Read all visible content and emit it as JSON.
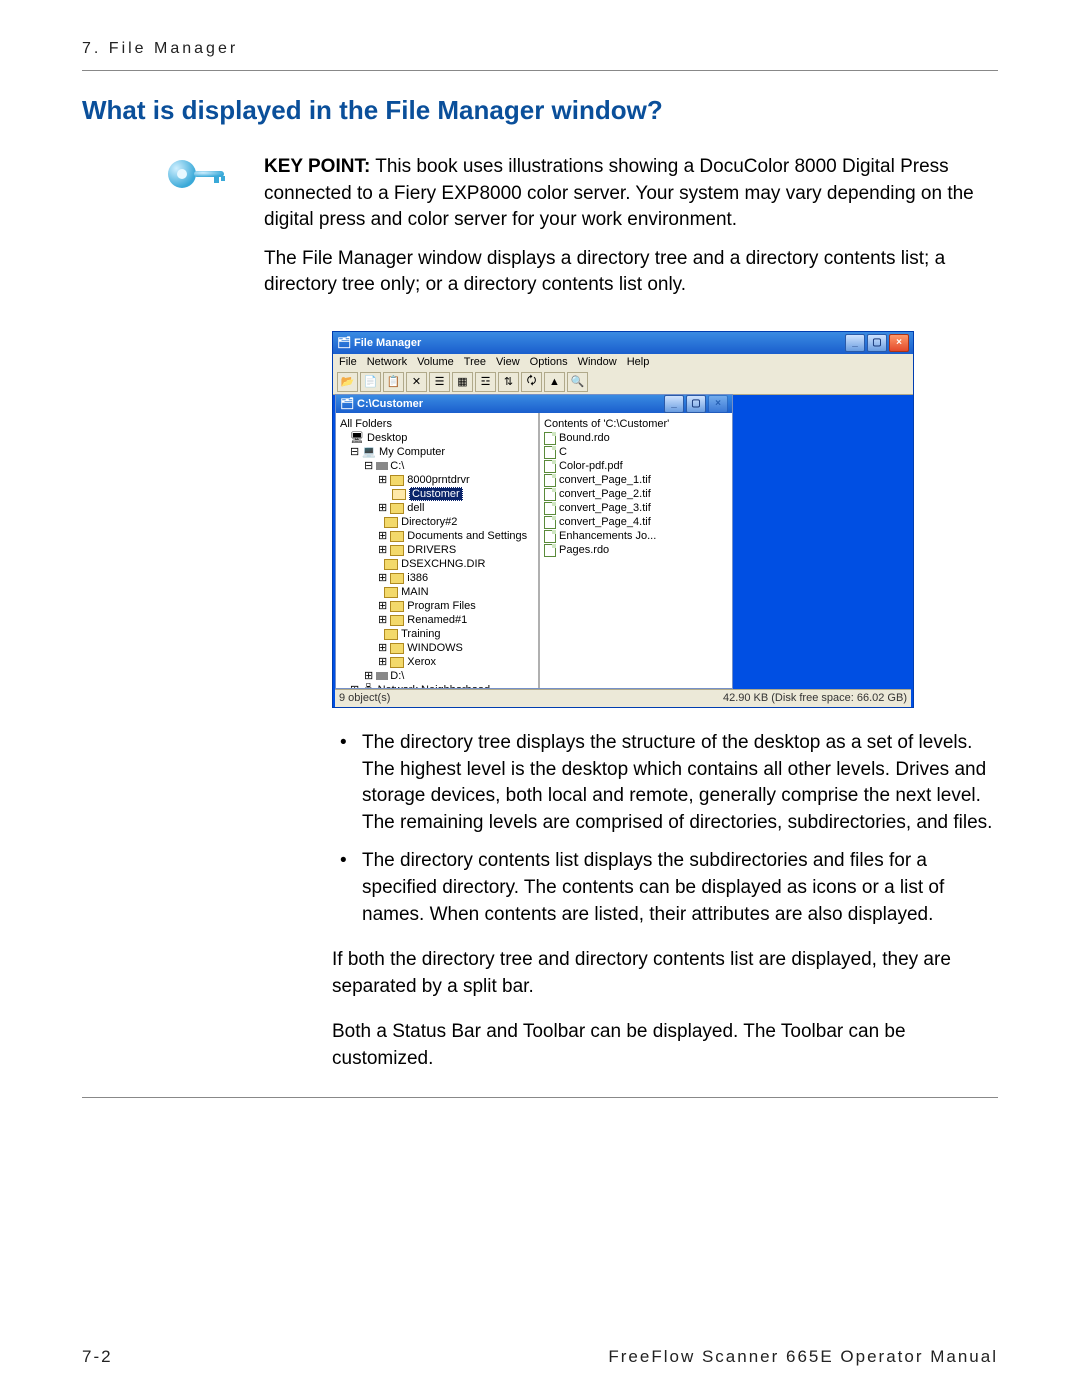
{
  "chapter_label": "7. File Manager",
  "section_heading": "What is displayed in the File Manager window?",
  "keypoint_label": "KEY POINT:",
  "keypoint_text": " This book uses illustrations showing a DocuColor 8000 Digital Press connected to a Fiery EXP8000 color server.  Your system may vary depending on the digital press and color server for your work environment.",
  "intro_para": "The File Manager window displays a directory tree and a directory contents list; a directory tree only; or a directory contents list only.",
  "bullet1": "The directory tree displays the structure of the desktop as a set of levels. The highest level is the desktop which contains all other levels. Drives and storage devices, both local and remote, generally comprise the next level. The remaining levels are comprised of directories, subdirectories, and files.",
  "bullet2": "The directory contents list displays the subdirectories and files for a specified directory. The contents can be displayed as icons or a list of names. When contents are listed, their attributes are also displayed.",
  "para_split": "If both the directory tree and directory contents list are displayed, they are separated by a split bar.",
  "para_status": "Both a Status Bar and Toolbar can be displayed. The Toolbar can be customized.",
  "footer_page": "7-2",
  "footer_manual": "FreeFlow Scanner 665E Operator Manual",
  "fm": {
    "title": "File Manager",
    "menus": [
      "File",
      "Network",
      "Volume",
      "Tree",
      "View",
      "Options",
      "Window",
      "Help"
    ],
    "inner_title": "C:\\Customer",
    "tree": {
      "root": "All Folders",
      "desktop": "Desktop",
      "my_computer": "My Computer",
      "drive_c": "C:\\",
      "items_c": [
        "8000prntdrvr",
        "Customer",
        "dell",
        "Directory#2",
        "Documents and Settings",
        "DRIVERS",
        "DSEXCHNG.DIR",
        "i386",
        "MAIN",
        "Program Files",
        "Renamed#1",
        "Training",
        "WINDOWS",
        "Xerox"
      ],
      "drive_d": "D:\\",
      "net": "Network Neighborhood"
    },
    "contents_header": "Contents of   'C:\\Customer'",
    "contents": [
      "Bound.rdo",
      "C",
      "Color-pdf.pdf",
      "convert_Page_1.tif",
      "convert_Page_2.tif",
      "convert_Page_3.tif",
      "convert_Page_4.tif",
      "Enhancements Jo...",
      "Pages.rdo"
    ],
    "status_left": "9  object(s)",
    "status_right": "42.90 KB  (Disk free space:  66.02 GB)"
  }
}
